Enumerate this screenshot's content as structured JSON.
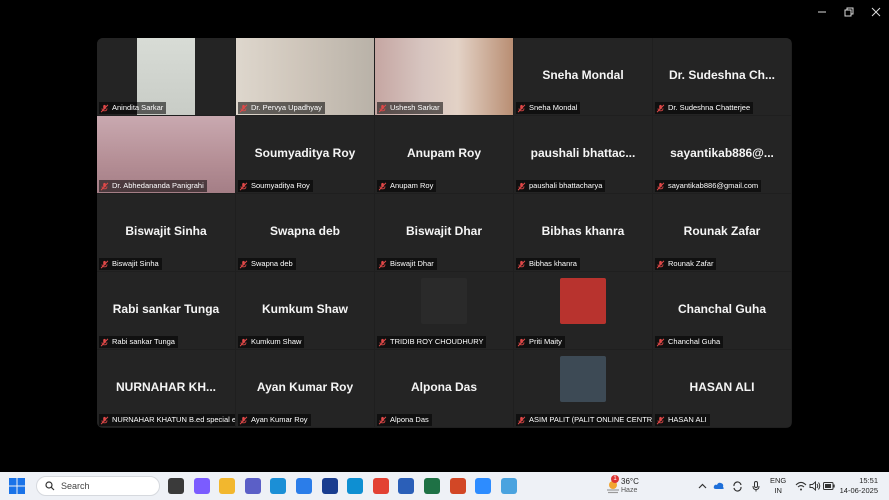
{
  "participants": [
    {
      "name": "Anindita Sarkar",
      "display": "",
      "video": "anindita"
    },
    {
      "name": "Dr. Pervya Upadhyay",
      "display": "",
      "video": "pervya"
    },
    {
      "name": "Ushesh Sarkar",
      "display": "",
      "video": "ushesh",
      "active": true
    },
    {
      "name": "Sneha Mondal",
      "display": "Sneha Mondal"
    },
    {
      "name": "Dr. Sudeshna Chatterjee",
      "display": "Dr. Sudeshna Ch..."
    },
    {
      "name": "Dr. Abhedananda Panigrahi",
      "display": "",
      "video": "abhed"
    },
    {
      "name": "Soumyaditya Roy",
      "display": "Soumyaditya Roy"
    },
    {
      "name": "Anupam Roy",
      "display": "Anupam Roy"
    },
    {
      "name": "paushali bhattacharya",
      "display": "paushali bhattac..."
    },
    {
      "name": "sayantikab886@gmail.com",
      "display": "sayantikab886@..."
    },
    {
      "name": "Biswajit Sinha",
      "display": "Biswajit Sinha"
    },
    {
      "name": "Swapna deb",
      "display": "Swapna deb"
    },
    {
      "name": "Biswajit Dhar",
      "display": "Biswajit Dhar"
    },
    {
      "name": "Bibhas khanra",
      "display": "Bibhas khanra"
    },
    {
      "name": "Rounak Zafar",
      "display": "Rounak Zafar"
    },
    {
      "name": "Rabi sankar Tunga",
      "display": "Rabi sankar Tunga"
    },
    {
      "name": "Kumkum Shaw",
      "display": "Kumkum Shaw"
    },
    {
      "name": "TRIDIB ROY CHOUDHURY",
      "display": "",
      "avatar": "#2a2a2a"
    },
    {
      "name": "Priti Maity",
      "display": "",
      "avatar": "#b8332e"
    },
    {
      "name": "Chanchal Guha",
      "display": "Chanchal Guha"
    },
    {
      "name": "NURNAHAR KHATUN B.ed special ed...",
      "display": "NURNAHAR KH..."
    },
    {
      "name": "Ayan Kumar Roy",
      "display": "Ayan Kumar Roy"
    },
    {
      "name": "Alpona Das",
      "display": "Alpona Das"
    },
    {
      "name": "ASIM PALIT (PALIT ONLINE CENTRE)",
      "display": "",
      "avatar": "#3d4a55"
    },
    {
      "name": "HASAN ALI",
      "display": "HASAN ALI"
    }
  ],
  "taskbar": {
    "search_placeholder": "Search",
    "weather_temp": "36°C",
    "weather_desc": "Haze",
    "weather_badge": "1",
    "lang_line1": "ENG",
    "lang_line2": "IN",
    "time": "15:51",
    "date": "14-06-2025",
    "apps": [
      {
        "name": "task-view",
        "color": "#3a3a3a"
      },
      {
        "name": "copilot",
        "color": "#7b5cff"
      },
      {
        "name": "file-explorer",
        "color": "#f2b72e"
      },
      {
        "name": "teams",
        "color": "#5b5fc7"
      },
      {
        "name": "edge",
        "color": "#1b8fd6"
      },
      {
        "name": "store",
        "color": "#2b7de9"
      },
      {
        "name": "app-l",
        "color": "#1a3d8f"
      },
      {
        "name": "photos",
        "color": "#0e8fd2"
      },
      {
        "name": "chrome",
        "color": "#e34133"
      },
      {
        "name": "word",
        "color": "#2b5fb8"
      },
      {
        "name": "excel",
        "color": "#1e7145"
      },
      {
        "name": "powerpoint",
        "color": "#d24726"
      },
      {
        "name": "zoom",
        "color": "#2d8cff"
      },
      {
        "name": "tablet-app",
        "color": "#4aa3df"
      }
    ]
  }
}
